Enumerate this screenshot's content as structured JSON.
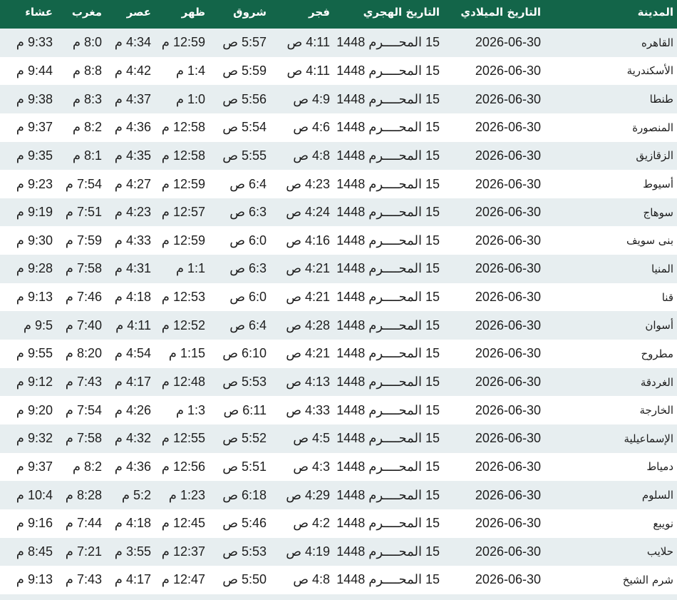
{
  "headers": {
    "city": "المدينة",
    "gregorian": "التاريخ الميلادي",
    "hijri": "التاريخ الهجري",
    "fajr": "فجر",
    "shurooq": "شروق",
    "dhuhr": "ظهر",
    "asr": "عصر",
    "maghrib": "مغرب",
    "isha": "عشاء"
  },
  "colors": {
    "header_bg": "#136549",
    "row_alt_bg": "#e7eef0"
  },
  "rows": [
    {
      "city": "القاهره",
      "gregorian": "2026-06-30",
      "hijri": "15 المحــــرم 1448",
      "fajr": "4:11 ص",
      "shurooq": "5:57 ص",
      "dhuhr": "12:59 م",
      "asr": "4:34 م",
      "maghrib": "8:0 م",
      "isha": "9:33 م"
    },
    {
      "city": "الأسكندرية",
      "gregorian": "2026-06-30",
      "hijri": "15 المحــــرم 1448",
      "fajr": "4:11 ص",
      "shurooq": "5:59 ص",
      "dhuhr": "1:4 م",
      "asr": "4:42 م",
      "maghrib": "8:8 م",
      "isha": "9:44 م"
    },
    {
      "city": "طنطا",
      "gregorian": "2026-06-30",
      "hijri": "15 المحــــرم 1448",
      "fajr": "4:9 ص",
      "shurooq": "5:56 ص",
      "dhuhr": "1:0 م",
      "asr": "4:37 م",
      "maghrib": "8:3 م",
      "isha": "9:38 م"
    },
    {
      "city": "المنصورة",
      "gregorian": "2026-06-30",
      "hijri": "15 المحــــرم 1448",
      "fajr": "4:6 ص",
      "shurooq": "5:54 ص",
      "dhuhr": "12:58 م",
      "asr": "4:36 م",
      "maghrib": "8:2 م",
      "isha": "9:37 م"
    },
    {
      "city": "الزقازيق",
      "gregorian": "2026-06-30",
      "hijri": "15 المحــــرم 1448",
      "fajr": "4:8 ص",
      "shurooq": "5:55 ص",
      "dhuhr": "12:58 م",
      "asr": "4:35 م",
      "maghrib": "8:1 م",
      "isha": "9:35 م"
    },
    {
      "city": "أسيوط",
      "gregorian": "2026-06-30",
      "hijri": "15 المحــــرم 1448",
      "fajr": "4:23 ص",
      "shurooq": "6:4 ص",
      "dhuhr": "12:59 م",
      "asr": "4:27 م",
      "maghrib": "7:54 م",
      "isha": "9:23 م"
    },
    {
      "city": "سوهاج",
      "gregorian": "2026-06-30",
      "hijri": "15 المحــــرم 1448",
      "fajr": "4:24 ص",
      "shurooq": "6:3 ص",
      "dhuhr": "12:57 م",
      "asr": "4:23 م",
      "maghrib": "7:51 م",
      "isha": "9:19 م"
    },
    {
      "city": "بنى سويف",
      "gregorian": "2026-06-30",
      "hijri": "15 المحــــرم 1448",
      "fajr": "4:16 ص",
      "shurooq": "6:0 ص",
      "dhuhr": "12:59 م",
      "asr": "4:33 م",
      "maghrib": "7:59 م",
      "isha": "9:30 م"
    },
    {
      "city": "المنيا",
      "gregorian": "2026-06-30",
      "hijri": "15 المحــــرم 1448",
      "fajr": "4:21 ص",
      "shurooq": "6:3 ص",
      "dhuhr": "1:1 م",
      "asr": "4:31 م",
      "maghrib": "7:58 م",
      "isha": "9:28 م"
    },
    {
      "city": "قنا",
      "gregorian": "2026-06-30",
      "hijri": "15 المحــــرم 1448",
      "fajr": "4:21 ص",
      "shurooq": "6:0 ص",
      "dhuhr": "12:53 م",
      "asr": "4:18 م",
      "maghrib": "7:46 م",
      "isha": "9:13 م"
    },
    {
      "city": "أسوان",
      "gregorian": "2026-06-30",
      "hijri": "15 المحــــرم 1448",
      "fajr": "4:28 ص",
      "shurooq": "6:4 ص",
      "dhuhr": "12:52 م",
      "asr": "4:11 م",
      "maghrib": "7:40 م",
      "isha": "9:5 م"
    },
    {
      "city": "مطروح",
      "gregorian": "2026-06-30",
      "hijri": "15 المحــــرم 1448",
      "fajr": "4:21 ص",
      "shurooq": "6:10 ص",
      "dhuhr": "1:15 م",
      "asr": "4:54 م",
      "maghrib": "8:20 م",
      "isha": "9:55 م"
    },
    {
      "city": "الغردقة",
      "gregorian": "2026-06-30",
      "hijri": "15 المحــــرم 1448",
      "fajr": "4:13 ص",
      "shurooq": "5:53 ص",
      "dhuhr": "12:48 م",
      "asr": "4:17 م",
      "maghrib": "7:43 م",
      "isha": "9:12 م"
    },
    {
      "city": "الخارجة",
      "gregorian": "2026-06-30",
      "hijri": "15 المحــــرم 1448",
      "fajr": "4:33 ص",
      "shurooq": "6:11 ص",
      "dhuhr": "1:3 م",
      "asr": "4:26 م",
      "maghrib": "7:54 م",
      "isha": "9:20 م"
    },
    {
      "city": "الإسماعيلية",
      "gregorian": "2026-06-30",
      "hijri": "15 المحــــرم 1448",
      "fajr": "4:5 ص",
      "shurooq": "5:52 ص",
      "dhuhr": "12:55 م",
      "asr": "4:32 م",
      "maghrib": "7:58 م",
      "isha": "9:32 م"
    },
    {
      "city": "دمياط",
      "gregorian": "2026-06-30",
      "hijri": "15 المحــــرم 1448",
      "fajr": "4:3 ص",
      "shurooq": "5:51 ص",
      "dhuhr": "12:56 م",
      "asr": "4:36 م",
      "maghrib": "8:2 م",
      "isha": "9:37 م"
    },
    {
      "city": "السلوم",
      "gregorian": "2026-06-30",
      "hijri": "15 المحــــرم 1448",
      "fajr": "4:29 ص",
      "shurooq": "6:18 ص",
      "dhuhr": "1:23 م",
      "asr": "5:2 م",
      "maghrib": "8:28 م",
      "isha": "10:4 م"
    },
    {
      "city": "نويبع",
      "gregorian": "2026-06-30",
      "hijri": "15 المحــــرم 1448",
      "fajr": "4:2 ص",
      "shurooq": "5:46 ص",
      "dhuhr": "12:45 م",
      "asr": "4:18 م",
      "maghrib": "7:44 م",
      "isha": "9:16 م"
    },
    {
      "city": "حلايب",
      "gregorian": "2026-06-30",
      "hijri": "15 المحــــرم 1448",
      "fajr": "4:19 ص",
      "shurooq": "5:53 ص",
      "dhuhr": "12:37 م",
      "asr": "3:55 م",
      "maghrib": "7:21 م",
      "isha": "8:45 م"
    },
    {
      "city": "شرم الشيخ",
      "gregorian": "2026-06-30",
      "hijri": "15 المحــــرم 1448",
      "fajr": "4:8 ص",
      "shurooq": "5:50 ص",
      "dhuhr": "12:47 م",
      "asr": "4:17 م",
      "maghrib": "7:43 م",
      "isha": "9:13 م"
    }
  ]
}
